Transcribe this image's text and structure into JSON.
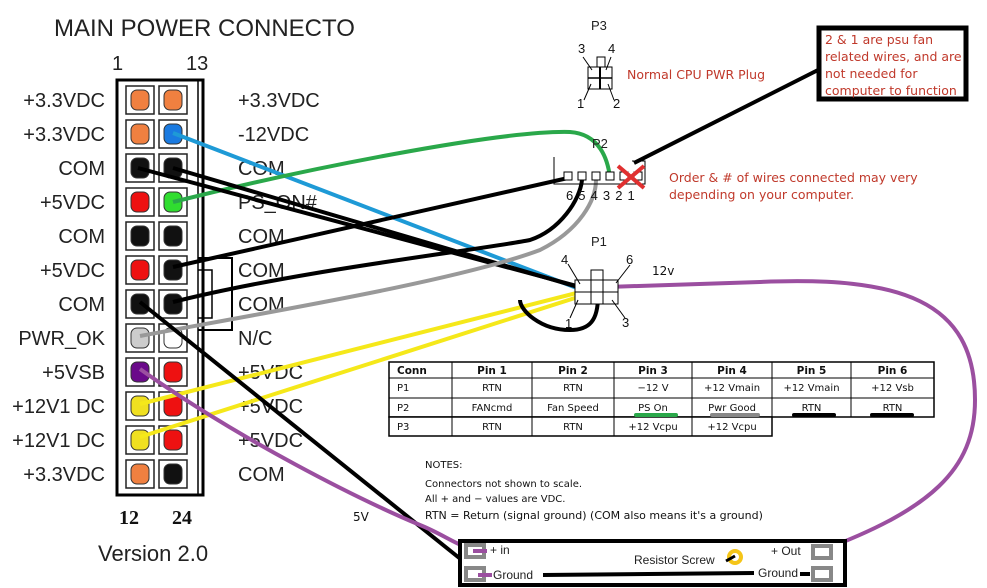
{
  "main_connector": {
    "title": "MAIN POWER CONNECTO",
    "top_left_number": "1",
    "top_right_number": "13",
    "bottom_left_number": "12",
    "bottom_right_number": "24",
    "version": "Version 2.0",
    "left_labels": [
      "+3.3VDC",
      "+3.3VDC",
      "COM",
      "+5VDC",
      "COM",
      "+5VDC",
      "COM",
      "PWR_OK",
      "+5VSB",
      "+12V1 DC",
      "+12V1 DC",
      "+3.3VDC"
    ],
    "right_labels": [
      "+3.3VDC",
      "-12VDC",
      "COM",
      "PS_ON#",
      "COM",
      "COM",
      "COM",
      "N/C",
      "+5VDC",
      "+5VDC",
      "+5VDC",
      "COM"
    ],
    "left_pin_colors": [
      "#f08040",
      "#f08040",
      "#111111",
      "#ee1111",
      "#111111",
      "#ee1111",
      "#111111",
      "#cccccc",
      "#6a0a8a",
      "#f0e020",
      "#f0e020",
      "#f08040"
    ],
    "right_pin_colors": [
      "#f08040",
      "#1a7ae0",
      "#111111",
      "#30dd30",
      "#111111",
      "#111111",
      "#111111",
      "#ffffff",
      "#ee1111",
      "#ee1111",
      "#ee1111",
      "#111111"
    ]
  },
  "p3": {
    "title": "P3",
    "pins": [
      "3",
      "4",
      "1",
      "2"
    ],
    "caption": "Normal CPU PWR Plug"
  },
  "p2": {
    "title": "P2",
    "pins": [
      "6",
      "5",
      "4",
      "3",
      "2",
      "1"
    ],
    "caption_line1": "Order & # of wires connected may very",
    "caption_line2": "depending on your computer."
  },
  "p1": {
    "title": "P1",
    "pins": [
      "4",
      "6",
      "1",
      "3"
    ],
    "wire_label": "12v"
  },
  "callout": {
    "lines": [
      "2 & 1 are psu fan",
      "related wires, and are",
      "not needed for",
      "computer to function"
    ]
  },
  "wire_5v_label": "5V",
  "pin_table": {
    "headers": [
      "Conn",
      "Pin 1",
      "Pin 2",
      "Pin 3",
      "Pin 4",
      "Pin 5",
      "Pin 6"
    ],
    "rows": [
      [
        "P1",
        "RTN",
        "RTN",
        "−12 V",
        "+12 Vmain",
        "+12 Vmain",
        "+12 Vsb"
      ],
      [
        "P2",
        "FANcmd",
        "Fan Speed",
        "PS On",
        "Pwr Good",
        "RTN",
        "RTN"
      ],
      [
        "P3",
        "RTN",
        "RTN",
        "+12 Vcpu",
        "+12 Vcpu",
        "",
        ""
      ]
    ]
  },
  "notes": {
    "title": "NOTES:",
    "lines": [
      "Connectors not shown to scale.",
      "All + and − values are VDC.",
      "RTN = Return (signal ground) (COM also means it's a ground)"
    ]
  },
  "board": {
    "plus_in": "+ in",
    "ground_in": "Ground",
    "resistor": "Resistor Screw",
    "plus_out": "+ Out",
    "ground_out": "Ground"
  },
  "colors": {
    "wire_blue": "#1e9ad6",
    "wire_green": "#2aa84a",
    "wire_gray": "#999999",
    "wire_yellow": "#f5e81a",
    "wire_purple": "#9b4fa0",
    "wire_black": "#000000",
    "annotation_red": "#c0392b"
  }
}
